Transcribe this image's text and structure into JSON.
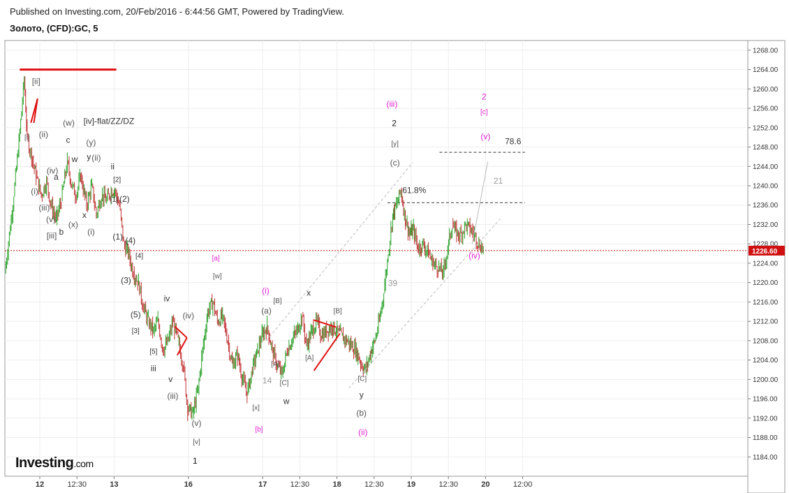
{
  "header": {
    "published": "Published on Investing.com, 20/Feb/2016 - 6:44:56 GMT, Powered by TradingView.",
    "symbol": "Золото, (CFD):GC, 5"
  },
  "brand": {
    "name": "Investing",
    "suffix": ".com"
  },
  "chart_data": {
    "type": "line",
    "title": "",
    "xlabel": "",
    "ylabel": "",
    "ylim": [
      1180,
      1270
    ],
    "xlim": [
      0,
      100
    ],
    "grid": true,
    "colors": {
      "up": "#27a127",
      "down": "#c03030",
      "annotation": "#e01010",
      "magenta": "#e020d0",
      "guide": "#bbbbbb",
      "price_line": "#c00000",
      "price_tag_bg": "#d01010"
    },
    "y_ticks": [
      "1184.00",
      "1188.00",
      "1192.00",
      "1196.00",
      "1200.00",
      "1204.00",
      "1208.00",
      "1212.00",
      "1216.00",
      "1220.00",
      "1224.00",
      "1228.00",
      "1232.00",
      "1236.00",
      "1240.00",
      "1244.00",
      "1248.00",
      "1252.00",
      "1256.00",
      "1260.00",
      "1264.00",
      "1268.00"
    ],
    "x_ticks": [
      {
        "x": 4.7,
        "label": "12"
      },
      {
        "x": 9.7,
        "label": "12:30"
      },
      {
        "x": 14.7,
        "label": "13"
      },
      {
        "x": 24.7,
        "label": "16"
      },
      {
        "x": 34.7,
        "label": "17"
      },
      {
        "x": 39.7,
        "label": "12:30"
      },
      {
        "x": 44.7,
        "label": "18"
      },
      {
        "x": 49.7,
        "label": "12:30"
      },
      {
        "x": 54.7,
        "label": "19"
      },
      {
        "x": 59.7,
        "label": "12:30"
      },
      {
        "x": 64.7,
        "label": "20"
      },
      {
        "x": 69.7,
        "label": "12:00"
      }
    ],
    "last_price": "1226.60",
    "series": [
      {
        "x": [
          0,
          0.6,
          1.2,
          2,
          2.6,
          3,
          3.6,
          4.2,
          4.9,
          5.6,
          6.2,
          6.9,
          7.6,
          8.4,
          9,
          9.6,
          10.2,
          11,
          11.7,
          12.3,
          13,
          13.7,
          14.3,
          14.8,
          15.4,
          16,
          16.6,
          17.3,
          18,
          18.6,
          19.3,
          20,
          20.6,
          21.3,
          22,
          22.6,
          23.3,
          24,
          24.6,
          25.3,
          26,
          26.6,
          27.3,
          28,
          28.6,
          29.3,
          30,
          30.6,
          31.3,
          32,
          32.6,
          33.3,
          34,
          34.6,
          35.3,
          36,
          36.6,
          37.3,
          38,
          38.6,
          39.3,
          40,
          40.6,
          41.3,
          42,
          42.6,
          43.3,
          44,
          44.6,
          45.3,
          46,
          46.6,
          47.3,
          48,
          48.6,
          49.3,
          49.8,
          50.4,
          51,
          51.6,
          52.2,
          52.7,
          53.3,
          53.9,
          54.5,
          55,
          55.6,
          56.3,
          57,
          57.6,
          58.3,
          59,
          59.6,
          60.2,
          60.8,
          61.4,
          62,
          62.6,
          63.2,
          63.8,
          64.4
        ],
        "y": [
          1222,
          1230,
          1238,
          1251,
          1262,
          1250,
          1246,
          1242,
          1238,
          1241,
          1236,
          1233,
          1237,
          1245,
          1240,
          1238,
          1242,
          1236,
          1240,
          1234,
          1238,
          1237,
          1239,
          1239,
          1236,
          1228,
          1226,
          1222,
          1220,
          1215,
          1212,
          1210,
          1212,
          1206,
          1208,
          1212,
          1208,
          1203,
          1194,
          1193,
          1198,
          1206,
          1214,
          1216,
          1212,
          1213,
          1208,
          1203,
          1205,
          1200,
          1197,
          1202,
          1206,
          1209,
          1211,
          1206,
          1203,
          1201,
          1206,
          1208,
          1210,
          1213,
          1207,
          1210,
          1212,
          1209,
          1210,
          1211,
          1210,
          1209,
          1208,
          1207,
          1206,
          1203,
          1202,
          1206,
          1208,
          1212,
          1218,
          1226,
          1234,
          1236,
          1239,
          1233,
          1230,
          1231,
          1227,
          1228,
          1226,
          1224,
          1223,
          1222,
          1227,
          1232,
          1230,
          1230,
          1232,
          1231,
          1230,
          1228,
          1227
        ]
      }
    ],
    "annotations": [
      {
        "text": "[ii]",
        "x": 4.2,
        "y": 1261,
        "color": "#555"
      },
      {
        "text": "[i]",
        "x": 3.0,
        "y": 1249.5,
        "color": "#555"
      },
      {
        "text": "(ii)",
        "x": 5.2,
        "y": 1250,
        "color": "#555"
      },
      {
        "text": "(iv)",
        "x": 6.4,
        "y": 1242.5,
        "color": "#555"
      },
      {
        "text": "(i)",
        "x": 4.0,
        "y": 1238.3,
        "color": "#555"
      },
      {
        "text": "(iii)",
        "x": 5.3,
        "y": 1234.9,
        "color": "#555"
      },
      {
        "text": "(v)",
        "x": 6.2,
        "y": 1232.5,
        "color": "#555"
      },
      {
        "text": "[iii]",
        "x": 6.3,
        "y": 1229.1,
        "color": "#555"
      },
      {
        "text": "a",
        "x": 6.9,
        "y": 1241.2,
        "color": "#333"
      },
      {
        "text": "b",
        "x": 7.6,
        "y": 1229.9,
        "color": "#333"
      },
      {
        "text": "(w)",
        "x": 8.6,
        "y": 1252.4,
        "color": "#555"
      },
      {
        "text": "c",
        "x": 8.5,
        "y": 1248.9,
        "color": "#333"
      },
      {
        "text": "w",
        "x": 9.4,
        "y": 1244.9,
        "color": "#333"
      },
      {
        "text": "(x)",
        "x": 9.2,
        "y": 1231.4,
        "color": "#555"
      },
      {
        "text": "x",
        "x": 10.7,
        "y": 1233.4,
        "color": "#333"
      },
      {
        "text": "(y)",
        "x": 11.6,
        "y": 1248.4,
        "color": "#555"
      },
      {
        "text": "y",
        "x": 11.3,
        "y": 1245.4,
        "color": "#333"
      },
      {
        "text": "(ii)",
        "x": 12.3,
        "y": 1245.2,
        "color": "#555"
      },
      {
        "text": "(i)",
        "x": 11.6,
        "y": 1229.9,
        "color": "#555"
      },
      {
        "text": "[iv]-flat/ZZ/DZ",
        "x": 14.0,
        "y": 1252.8,
        "color": "#333"
      },
      {
        "text": "ii",
        "x": 14.5,
        "y": 1243.4,
        "color": "#333"
      },
      {
        "text": "[2]",
        "x": 15.1,
        "y": 1240.8,
        "color": "#333"
      },
      {
        "text": "[1]",
        "x": 14.7,
        "y": 1236.7,
        "color": "#333"
      },
      {
        "text": "(2)",
        "x": 16.1,
        "y": 1236.7,
        "color": "#333"
      },
      {
        "text": "(1)",
        "x": 15.2,
        "y": 1228.9,
        "color": "#333"
      },
      {
        "text": "(4)",
        "x": 16.9,
        "y": 1228.1,
        "color": "#333"
      },
      {
        "text": "[4]",
        "x": 18.1,
        "y": 1225.1,
        "color": "#333"
      },
      {
        "text": "(3)",
        "x": 16.3,
        "y": 1219.9,
        "color": "#333"
      },
      {
        "text": "(5)",
        "x": 17.6,
        "y": 1212.8,
        "color": "#333"
      },
      {
        "text": "[3]",
        "x": 17.6,
        "y": 1209.6,
        "color": "#333"
      },
      {
        "text": "[5]",
        "x": 20.0,
        "y": 1205.3,
        "color": "#333"
      },
      {
        "text": "iv",
        "x": 21.8,
        "y": 1216.1,
        "color": "#333"
      },
      {
        "text": "iii",
        "x": 20.0,
        "y": 1201.7,
        "color": "#333"
      },
      {
        "text": "(iv)",
        "x": 24.7,
        "y": 1212.6,
        "color": "#555"
      },
      {
        "text": "v",
        "x": 22.3,
        "y": 1199.5,
        "color": "#333"
      },
      {
        "text": "(iii)",
        "x": 22.6,
        "y": 1196.0,
        "color": "#555"
      },
      {
        "text": "(v)",
        "x": 25.8,
        "y": 1190.4,
        "color": "#555"
      },
      {
        "text": "[v]",
        "x": 25.8,
        "y": 1186.6,
        "color": "#555"
      },
      {
        "text": "1",
        "x": 25.6,
        "y": 1182.6,
        "color": "#111"
      },
      {
        "text": "[a]",
        "x": 28.4,
        "y": 1224.6,
        "color": "#e020d0"
      },
      {
        "text": "[w]",
        "x": 28.6,
        "y": 1220.9,
        "color": "#555"
      },
      {
        "text": "[x]",
        "x": 33.8,
        "y": 1193.7,
        "color": "#555"
      },
      {
        "text": "[b]",
        "x": 34.2,
        "y": 1189.2,
        "color": "#e020d0"
      },
      {
        "text": "(i)",
        "x": 35.1,
        "y": 1217.7,
        "color": "#e020d0"
      },
      {
        "text": "(a)",
        "x": 35.2,
        "y": 1213.6,
        "color": "#555"
      },
      {
        "text": "[B]",
        "x": 36.7,
        "y": 1215.8,
        "color": "#555"
      },
      {
        "text": "14",
        "x": 35.3,
        "y": 1199.2,
        "color": "#999"
      },
      {
        "text": "[A]",
        "x": 36.4,
        "y": 1202.7,
        "color": "#555"
      },
      {
        "text": "[C]",
        "x": 37.6,
        "y": 1198.8,
        "color": "#555"
      },
      {
        "text": "w",
        "x": 37.9,
        "y": 1194.9,
        "color": "#333"
      },
      {
        "text": "x",
        "x": 40.9,
        "y": 1217.3,
        "color": "#333"
      },
      {
        "text": "[A]",
        "x": 41.0,
        "y": 1204.0,
        "color": "#555"
      },
      {
        "text": "[B]",
        "x": 44.8,
        "y": 1213.7,
        "color": "#555"
      },
      {
        "text": "[C]",
        "x": 48.1,
        "y": 1199.7,
        "color": "#555"
      },
      {
        "text": "y",
        "x": 48.0,
        "y": 1196.2,
        "color": "#333"
      },
      {
        "text": "(b)",
        "x": 48.0,
        "y": 1192.5,
        "color": "#555"
      },
      {
        "text": "(ii)",
        "x": 48.2,
        "y": 1188.5,
        "color": "#e020d0"
      },
      {
        "text": "(iii)",
        "x": 52.1,
        "y": 1256.3,
        "color": "#e020d0"
      },
      {
        "text": "2",
        "x": 52.4,
        "y": 1252.3,
        "color": "#111"
      },
      {
        "text": "[y]",
        "x": 52.5,
        "y": 1248.2,
        "color": "#555"
      },
      {
        "text": "(c)",
        "x": 52.5,
        "y": 1244.2,
        "color": "#555"
      },
      {
        "text": "61.8%",
        "x": 55.1,
        "y": 1238.5,
        "color": "#333"
      },
      {
        "text": "39",
        "x": 52.2,
        "y": 1219.3,
        "color": "#999"
      },
      {
        "text": "(iv)",
        "x": 63.2,
        "y": 1225.0,
        "color": "#e020d0"
      },
      {
        "text": "2",
        "x": 64.5,
        "y": 1257.8,
        "color": "#e020d0"
      },
      {
        "text": "[c]",
        "x": 64.5,
        "y": 1254.8,
        "color": "#e020d0"
      },
      {
        "text": "(v)",
        "x": 64.7,
        "y": 1249.6,
        "color": "#e020d0"
      },
      {
        "text": "78.6",
        "x": 68.4,
        "y": 1248.6,
        "color": "#333"
      },
      {
        "text": "21",
        "x": 66.4,
        "y": 1240.4,
        "color": "#999"
      }
    ],
    "hlines": [
      {
        "y": 1236.5,
        "x1": 51.5,
        "x2": 70.0,
        "style": "dashed",
        "color": "#333"
      },
      {
        "y": 1246.9,
        "x1": 58.5,
        "x2": 70.0,
        "style": "dashed",
        "color": "#333"
      },
      {
        "y": 1264.0,
        "x1": 2.0,
        "x2": 15.0,
        "style": "solid",
        "color": "#e01010",
        "width": 3
      }
    ],
    "segments": [
      {
        "x1": 3.5,
        "y1": 1253,
        "x2": 4.4,
        "y2": 1258,
        "color": "#e01010"
      },
      {
        "x1": 3.9,
        "y1": 1253,
        "x2": 4.4,
        "y2": 1258,
        "color": "#e01010"
      },
      {
        "x1": 22.9,
        "y1": 1210.9,
        "x2": 24.5,
        "y2": 1208.6,
        "color": "#e01010"
      },
      {
        "x1": 23.2,
        "y1": 1205.0,
        "x2": 24.5,
        "y2": 1208.6,
        "color": "#e01010"
      },
      {
        "x1": 41.5,
        "y1": 1212.3,
        "x2": 44.6,
        "y2": 1210.8,
        "color": "#e01010"
      },
      {
        "x1": 41.6,
        "y1": 1201.8,
        "x2": 45.1,
        "y2": 1209.5,
        "color": "#e01010"
      },
      {
        "x1": 35.2,
        "y1": 1208.0,
        "x2": 54.9,
        "y2": 1244.8,
        "color": "#bbbbbb",
        "style": "dashed"
      },
      {
        "x1": 46.3,
        "y1": 1198.2,
        "x2": 66.7,
        "y2": 1233.2,
        "color": "#bbbbbb",
        "style": "dashed"
      },
      {
        "x1": 62.9,
        "y1": 1228.0,
        "x2": 65.0,
        "y2": 1245.0,
        "color": "#bbbbbb",
        "style": "solid"
      }
    ]
  }
}
